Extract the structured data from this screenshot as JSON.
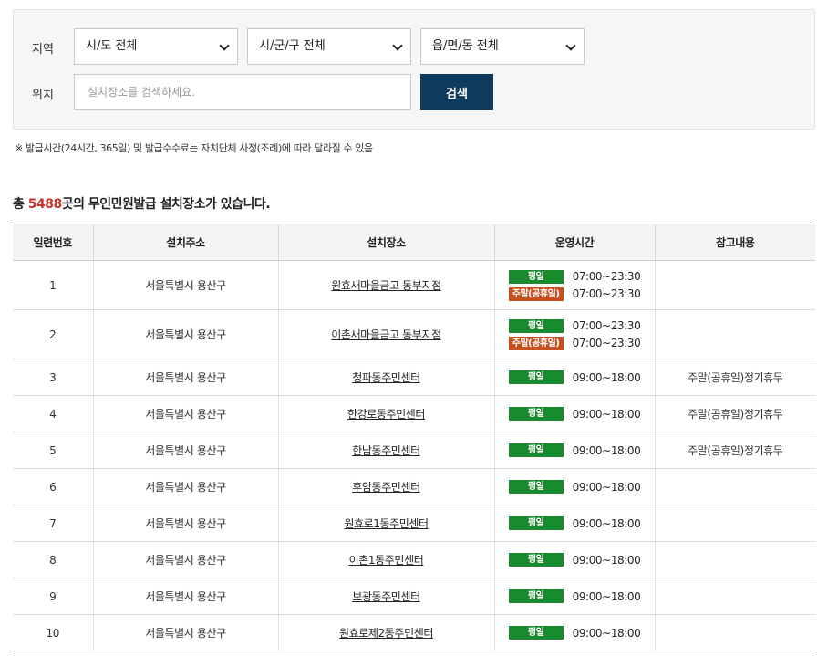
{
  "filters": {
    "region_label": "지역",
    "sido": "시/도 전체",
    "sigungu": "시/군/구 전체",
    "eupmyeondong": "읍/면/동 전체",
    "location_label": "위치",
    "search_placeholder": "설치장소를 검색하세요.",
    "search_button": "검색"
  },
  "notice": "※ 발급시간(24시간, 365일) 및 발급수수료는 자치단체 사정(조례)에 따라 달라질 수 있음",
  "summary": {
    "prefix": "총 ",
    "count": "5488",
    "suffix": "곳의 무인민원발급 설치장소가 있습니다."
  },
  "table": {
    "headers": [
      "일련번호",
      "설치주소",
      "설치장소",
      "운영시간",
      "참고내용"
    ],
    "rows": [
      {
        "no": "1",
        "address": "서울특별시 용산구",
        "place": "원효새마을금고 동부지점",
        "hours": [
          {
            "type": "평일",
            "time": "07:00~23:30"
          },
          {
            "type": "주말(공휴일)",
            "time": "07:00~23:30"
          }
        ],
        "note": ""
      },
      {
        "no": "2",
        "address": "서울특별시 용산구",
        "place": "이촌새마을금고 동부지점",
        "hours": [
          {
            "type": "평일",
            "time": "07:00~23:30"
          },
          {
            "type": "주말(공휴일)",
            "time": "07:00~23:30"
          }
        ],
        "note": ""
      },
      {
        "no": "3",
        "address": "서울특별시 용산구",
        "place": "청파동주민센터",
        "hours": [
          {
            "type": "평일",
            "time": "09:00~18:00"
          }
        ],
        "note": "주말(공휴일)정기휴무"
      },
      {
        "no": "4",
        "address": "서울특별시 용산구",
        "place": "한강로동주민센터",
        "hours": [
          {
            "type": "평일",
            "time": "09:00~18:00"
          }
        ],
        "note": "주말(공휴일)정기휴무"
      },
      {
        "no": "5",
        "address": "서울특별시 용산구",
        "place": "한남동주민센터",
        "hours": [
          {
            "type": "평일",
            "time": "09:00~18:00"
          }
        ],
        "note": "주말(공휴일)정기휴무"
      },
      {
        "no": "6",
        "address": "서울특별시 용산구",
        "place": "후암동주민센터",
        "hours": [
          {
            "type": "평일",
            "time": "09:00~18:00"
          }
        ],
        "note": ""
      },
      {
        "no": "7",
        "address": "서울특별시 용산구",
        "place": "원효로1동주민센터",
        "hours": [
          {
            "type": "평일",
            "time": "09:00~18:00"
          }
        ],
        "note": ""
      },
      {
        "no": "8",
        "address": "서울특별시 용산구",
        "place": "이촌1동주민센터",
        "hours": [
          {
            "type": "평일",
            "time": "09:00~18:00"
          }
        ],
        "note": ""
      },
      {
        "no": "9",
        "address": "서울특별시 용산구",
        "place": "보광동주민센터",
        "hours": [
          {
            "type": "평일",
            "time": "09:00~18:00"
          }
        ],
        "note": ""
      },
      {
        "no": "10",
        "address": "서울특별시 용산구",
        "place": "원효로제2동주민센터",
        "hours": [
          {
            "type": "평일",
            "time": "09:00~18:00"
          }
        ],
        "note": ""
      }
    ]
  },
  "colors": {
    "weekday_badge": "#1a8a2e",
    "weekend_badge": "#c8501e",
    "search_button": "#0f3a5f",
    "count_highlight": "#c0392b"
  }
}
